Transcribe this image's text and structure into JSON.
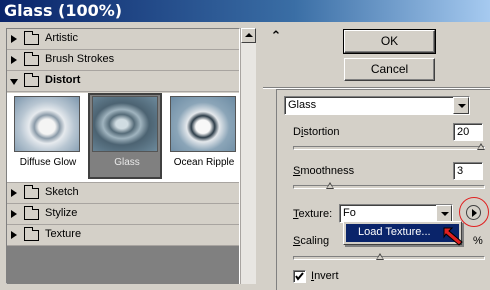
{
  "window": {
    "title": "Glass (100%)"
  },
  "filter_tree": {
    "categories": [
      {
        "label": "Artistic",
        "expanded": false
      },
      {
        "label": "Brush Strokes",
        "expanded": false
      },
      {
        "label": "Distort",
        "expanded": true
      },
      {
        "label": "Sketch",
        "expanded": false
      },
      {
        "label": "Stylize",
        "expanded": false
      },
      {
        "label": "Texture",
        "expanded": false
      }
    ],
    "distort_filters": [
      {
        "label": "Diffuse Glow",
        "selected": false
      },
      {
        "label": "Glass",
        "selected": true
      },
      {
        "label": "Ocean Ripple",
        "selected": false
      }
    ]
  },
  "actions": {
    "ok_label": "OK",
    "cancel_label": "Cancel"
  },
  "settings": {
    "filter_select": "Glass",
    "distortion": {
      "label_first": "D",
      "label_u": "i",
      "label_rest": "stortion",
      "value": "20",
      "level": 1.0
    },
    "smoothness": {
      "label_first": "",
      "label_u": "S",
      "label_rest": "moothness",
      "value": "3",
      "level": 0.18
    },
    "texture": {
      "label_first": "",
      "label_u": "T",
      "label_rest": "exture:",
      "value": "Fo"
    },
    "texture_menu_item": "Load Texture...",
    "scaling": {
      "label_first": "",
      "label_u": "S",
      "label_rest": "caling",
      "value_suffix": "%",
      "level": 0.45
    },
    "invert": {
      "label_first": "",
      "label_u": "I",
      "label_rest": "nvert",
      "checked": true
    }
  },
  "icons": {
    "collapse": "double-chevron-up-icon",
    "texture_menu": "play-circle-icon",
    "pointer": "red-arrow-icon",
    "check": "checkmark-icon"
  },
  "colors": {
    "titlebar": "#0a246a",
    "menu_highlight": "#0a246a",
    "annotation": "#e02020"
  }
}
